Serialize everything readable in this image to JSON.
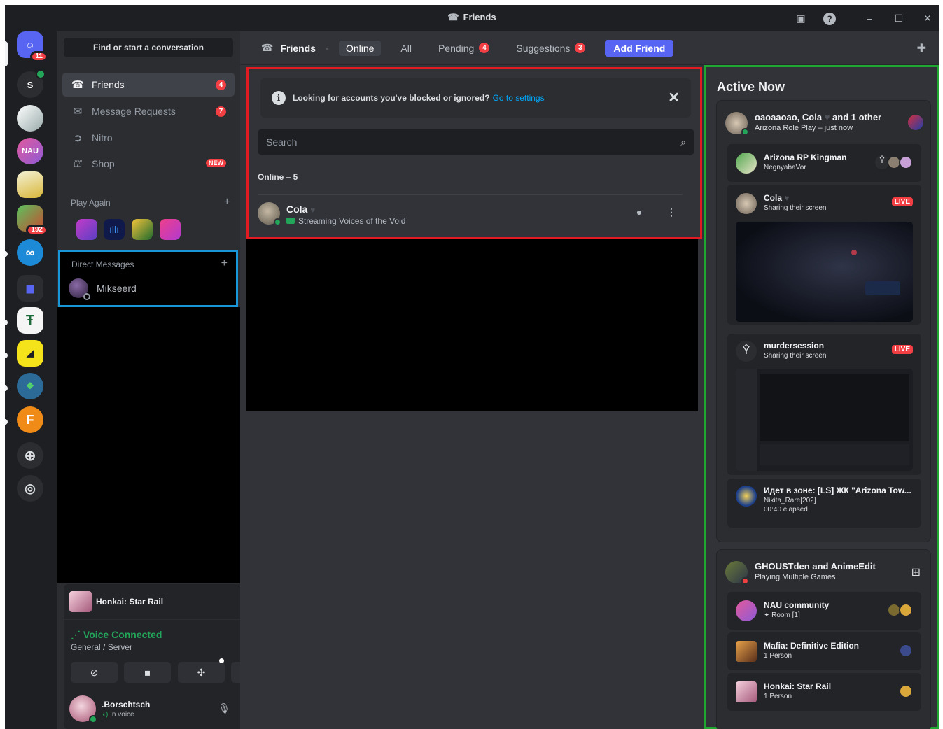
{
  "window": {
    "title": "Friends"
  },
  "servers": {
    "home_badge": "11",
    "s_label": "S",
    "nau_label": "NAU",
    "game_badge": "192",
    "f_label": "F"
  },
  "sidebar": {
    "search_placeholder": "Find or start a conversation",
    "items": [
      {
        "label": "Friends",
        "count": "4"
      },
      {
        "label": "Message Requests",
        "count": "7"
      },
      {
        "label": "Nitro"
      },
      {
        "label": "Shop",
        "tag": "NEW"
      }
    ],
    "play_again_header": "Play Again",
    "dm_header": "Direct Messages",
    "dm_items": [
      {
        "name": "Mikseerd"
      }
    ]
  },
  "activity_panel": {
    "game": "Honkai: Star Rail"
  },
  "voice_panel": {
    "status": "Voice Connected",
    "channel": "General / Server"
  },
  "user_panel": {
    "name": ".Borschtsch",
    "status": "In voice"
  },
  "topbar": {
    "title": "Friends",
    "tabs": [
      {
        "label": "Online",
        "selected": true
      },
      {
        "label": "All"
      },
      {
        "label": "Pending",
        "count": "4"
      },
      {
        "label": "Suggestions",
        "count": "3"
      }
    ],
    "add_friend": "Add Friend"
  },
  "friends": {
    "notice_text": "Looking for accounts you've blocked or ignored?",
    "notice_link": "Go to settings",
    "search_placeholder": "Search",
    "online_header": "Online – 5",
    "list": [
      {
        "name": "Cola",
        "status": "Streaming Voices of the Void"
      }
    ]
  },
  "active_now": {
    "title": "Active Now",
    "card1": {
      "title": "oaoaaoao, Cola",
      "title_suffix": "and 1 other",
      "subtitle": "Arizona Role Play – just now",
      "entries": [
        {
          "title": "Arizona RP Kingman",
          "subtitle": "NegnyabaVor"
        },
        {
          "title": "Cola",
          "subtitle": "Sharing their screen",
          "live": "LIVE"
        },
        {
          "title": "murdersession",
          "subtitle": "Sharing their screen",
          "live": "LIVE"
        },
        {
          "title": "Идет в зоне: [LS] ЖК \"Arizona Tow...",
          "subtitle": "Nikita_Rare[202]",
          "extra": "00:40 elapsed"
        }
      ]
    },
    "card2": {
      "title": "GHOUSTden and AnimeEdit",
      "subtitle": "Playing Multiple Games",
      "entries": [
        {
          "title": "NAU community",
          "subtitle": "✦ Room [1]"
        },
        {
          "title": "Mafia: Definitive Edition",
          "subtitle": "1 Person"
        },
        {
          "title": "Honkai: Star Rail",
          "subtitle": "1 Person"
        }
      ]
    }
  },
  "colors": {
    "accent": "#5865f2",
    "danger": "#f23f43",
    "online": "#23a55a",
    "highlight_red": "#e21b22",
    "highlight_blue": "#1996d8",
    "highlight_green": "#1fa732"
  }
}
